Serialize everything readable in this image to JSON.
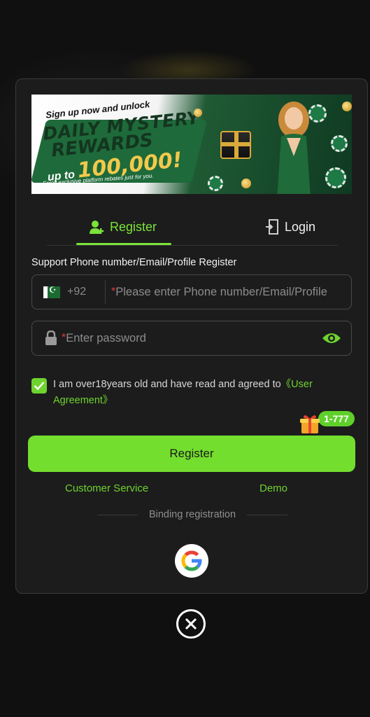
{
  "banner": {
    "line1": "Sign up now and unlock",
    "line2": "DAILY MYSTERY",
    "line3": "REWARDS",
    "line4_prefix": "up to",
    "line4_amount": "100,000!",
    "line5": "Enjoy exclusive platform rebates just for you."
  },
  "tabs": {
    "register": "Register",
    "login": "Login"
  },
  "form": {
    "section_label": "Support Phone number/Email/Profile Register",
    "country_code": "+92",
    "required_mark": "*",
    "phone_placeholder": "Please enter Phone number/Email/Profile",
    "password_placeholder": "Enter password"
  },
  "agreement": {
    "checked": true,
    "text": "I am over18years old and have read and agreed to",
    "link": "《User Agreement》"
  },
  "bonus_badge": "1-777",
  "buttons": {
    "register": "Register",
    "customer_service": "Customer Service",
    "demo": "Demo"
  },
  "binding_label": "Binding registration",
  "colors": {
    "accent": "#74de2f",
    "background": "#1c1c1c",
    "required": "#e03c3c"
  },
  "icons": [
    "user-add-icon",
    "login-door-icon",
    "pakistan-flag-icon",
    "lock-icon",
    "eye-icon",
    "check-icon",
    "gift-icon",
    "google-icon",
    "close-icon"
  ]
}
